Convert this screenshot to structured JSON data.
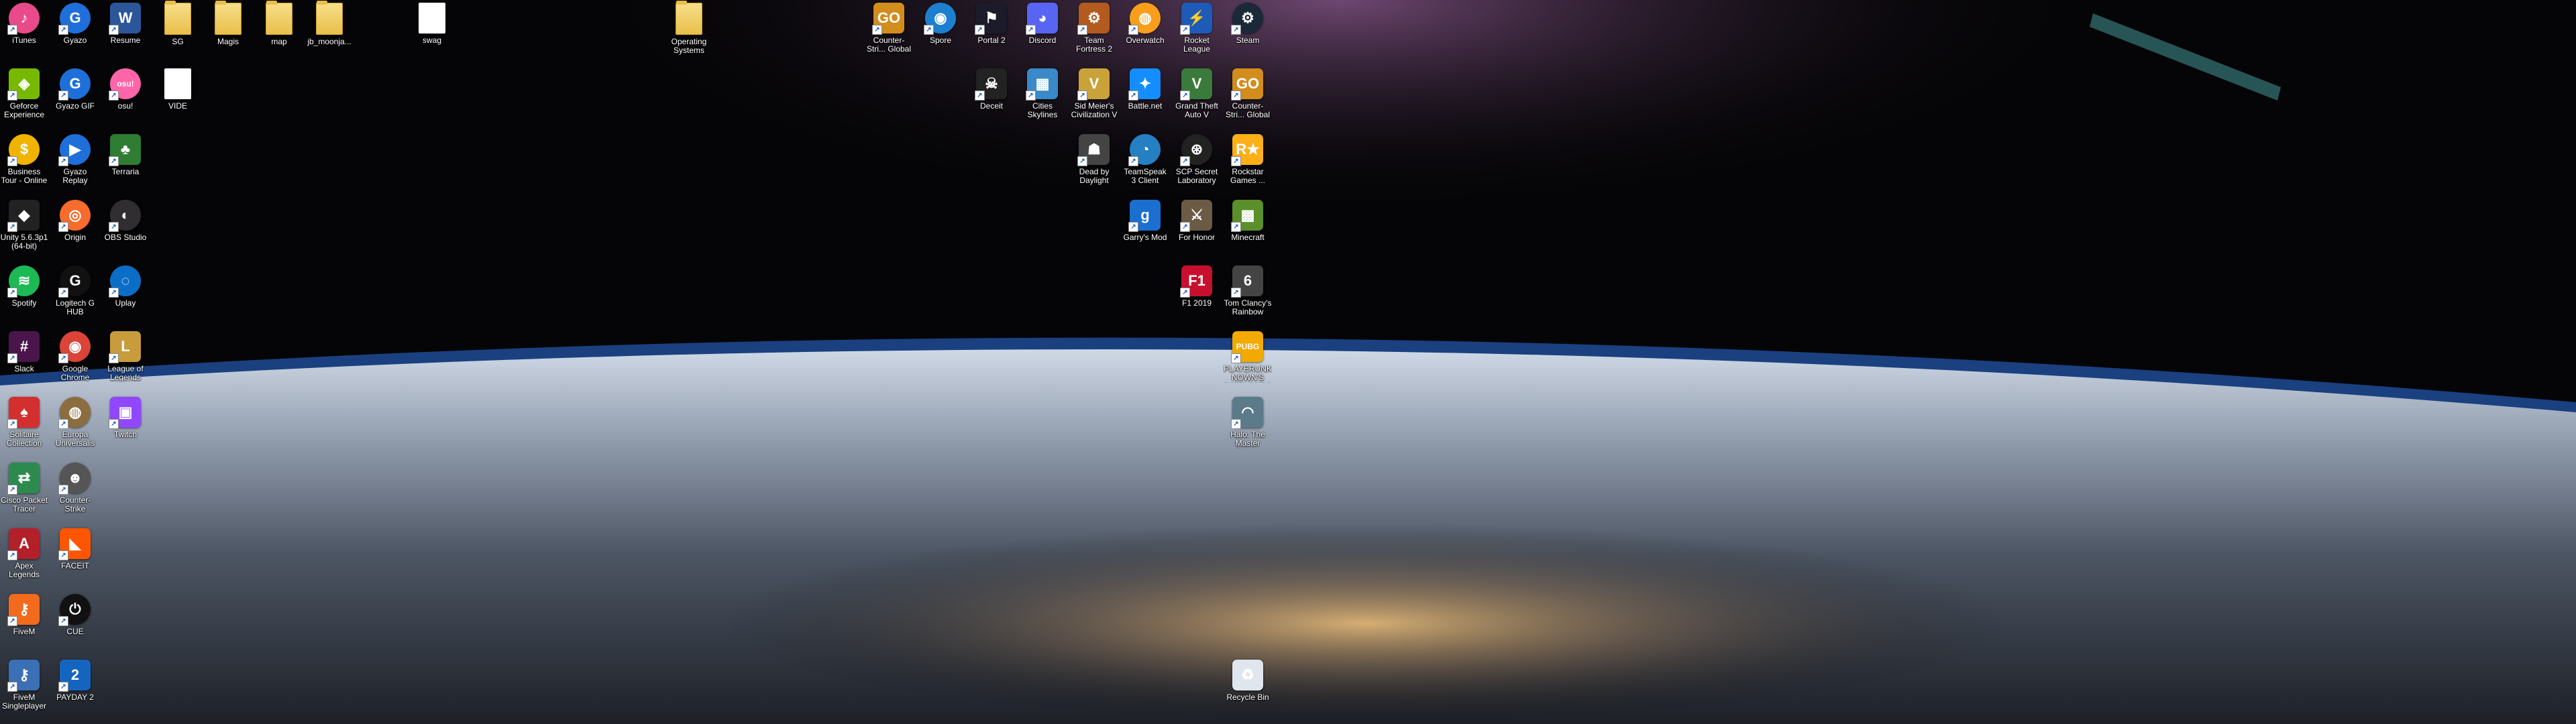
{
  "desktop": {
    "icons": [
      {
        "label": "iTunes",
        "icon": "itunes-icon",
        "symbol": "♪",
        "color": "#e84a8a",
        "round": true,
        "shortcut": true
      },
      {
        "label": "Gyazo",
        "icon": "gyazo-icon",
        "symbol": "G",
        "color": "#1e6fd9",
        "round": true,
        "shortcut": true
      },
      {
        "label": "Resume",
        "icon": "word-icon",
        "symbol": "W",
        "color": "#2b579a",
        "shortcut": true
      },
      {
        "label": "SG",
        "icon": "folder-icon",
        "folder": true
      },
      {
        "label": "Magis",
        "icon": "folder-icon",
        "folder": true
      },
      {
        "label": "map",
        "icon": "folder-icon",
        "folder": true
      },
      {
        "label": "jb_moonja...",
        "icon": "folder-icon",
        "folder": true
      },
      {
        "label": "swag",
        "icon": "pdf-icon",
        "doc": true
      },
      {
        "label": "Operating Systems",
        "icon": "folder-icon",
        "folder": true
      },
      {
        "label": "Counter-Stri... Global Offe...",
        "icon": "csgo-icon",
        "symbol": "GO",
        "color": "#d28d1c",
        "shortcut": true
      },
      {
        "label": "Spore",
        "icon": "spore-icon",
        "symbol": "◉",
        "color": "#1d7fd0",
        "round": true,
        "shortcut": true
      },
      {
        "label": "Portal 2",
        "icon": "portal2-icon",
        "symbol": "⚑",
        "color": "#1b1b2a",
        "shortcut": true
      },
      {
        "label": "Discord",
        "icon": "discord-icon",
        "symbol": "◕",
        "color": "#5865f2",
        "shortcut": true
      },
      {
        "label": "Team Fortress 2",
        "icon": "tf2-icon",
        "symbol": "⚙",
        "color": "#b35a1f",
        "shortcut": true
      },
      {
        "label": "Overwatch",
        "icon": "overwatch-icon",
        "symbol": "◍",
        "color": "#f99e1a",
        "round": true,
        "shortcut": true
      },
      {
        "label": "Rocket League",
        "icon": "rocket-league-icon",
        "symbol": "⚡",
        "color": "#1e5ab8",
        "shortcut": true
      },
      {
        "label": "Steam",
        "icon": "steam-icon",
        "symbol": "⚙",
        "color": "#1b2838",
        "round": true,
        "shortcut": true
      },
      {
        "label": "Geforce Experience",
        "icon": "geforce-icon",
        "symbol": "◈",
        "color": "#76b900",
        "shortcut": true
      },
      {
        "label": "Gyazo GIF",
        "icon": "gyazo-gif-icon",
        "symbol": "G",
        "color": "#1e6fd9",
        "round": true,
        "shortcut": true
      },
      {
        "label": "osu!",
        "icon": "osu-icon",
        "symbol": "osu!",
        "color": "#ff66aa",
        "round": true,
        "shortcut": true
      },
      {
        "label": "VIDE",
        "icon": "file-icon",
        "doc": true
      },
      {
        "label": "Deceit",
        "icon": "deceit-icon",
        "symbol": "☠",
        "color": "#222",
        "shortcut": true
      },
      {
        "label": "Cities Skylines",
        "icon": "cities-skylines-icon",
        "symbol": "▦",
        "color": "#3a89c9",
        "shortcut": true
      },
      {
        "label": "Sid Meier's Civilization V",
        "icon": "civ5-icon",
        "symbol": "V",
        "color": "#c9a23a",
        "shortcut": true
      },
      {
        "label": "Battle.net",
        "icon": "battlenet-icon",
        "symbol": "✦",
        "color": "#148eff",
        "shortcut": true
      },
      {
        "label": "Grand Theft Auto V",
        "icon": "gta5-icon",
        "symbol": "V",
        "color": "#3a7a3a",
        "shortcut": true
      },
      {
        "label": "Counter-Stri... Global Offe...",
        "icon": "csgo-icon",
        "symbol": "GO",
        "color": "#d28d1c",
        "shortcut": true
      },
      {
        "label": "Business Tour - Online M...",
        "icon": "business-tour-icon",
        "symbol": "$",
        "color": "#f0b400",
        "round": true,
        "shortcut": true
      },
      {
        "label": "Gyazo Replay",
        "icon": "gyazo-replay-icon",
        "symbol": "▶",
        "color": "#1e6fd9",
        "round": true,
        "shortcut": true
      },
      {
        "label": "Terraria",
        "icon": "terraria-icon",
        "symbol": "♣",
        "color": "#2e7d32",
        "shortcut": true
      },
      {
        "label": "Dead by Daylight",
        "icon": "dead-by-daylight-icon",
        "symbol": "☗",
        "color": "#444",
        "shortcut": true
      },
      {
        "label": "TeamSpeak 3 Client",
        "icon": "teamspeak-icon",
        "symbol": "◔",
        "color": "#2580c3",
        "round": true,
        "shortcut": true
      },
      {
        "label": "SCP Secret Laboratory",
        "icon": "scp-icon",
        "symbol": "⊛",
        "color": "#222",
        "round": true,
        "shortcut": true
      },
      {
        "label": "Rockstar Games ...",
        "icon": "rockstar-icon",
        "symbol": "R★",
        "color": "#fcaf17",
        "shortcut": true
      },
      {
        "label": "Unity 5.6.3p1 (64-bit)",
        "icon": "unity-icon",
        "symbol": "◆",
        "color": "#222",
        "shortcut": true
      },
      {
        "label": "Origin",
        "icon": "origin-icon",
        "symbol": "◎",
        "color": "#f56c2d",
        "round": true,
        "shortcut": true
      },
      {
        "label": "OBS Studio",
        "icon": "obs-icon",
        "symbol": "◐",
        "color": "#302e31",
        "round": true,
        "shortcut": true
      },
      {
        "label": "Garry's Mod",
        "icon": "garrys-mod-icon",
        "symbol": "g",
        "color": "#1a6fd1",
        "shortcut": true
      },
      {
        "label": "For Honor",
        "icon": "for-honor-icon",
        "symbol": "⚔",
        "color": "#6b5b45",
        "shortcut": true
      },
      {
        "label": "Minecraft",
        "icon": "minecraft-icon",
        "symbol": "▩",
        "color": "#5a8f2b",
        "shortcut": true
      },
      {
        "label": "Spotify",
        "icon": "spotify-icon",
        "symbol": "≋",
        "color": "#1db954",
        "round": true,
        "shortcut": true
      },
      {
        "label": "Logitech G HUB",
        "icon": "logitech-ghub-icon",
        "symbol": "G",
        "color": "#111",
        "round": true,
        "shortcut": true
      },
      {
        "label": "Uplay",
        "icon": "uplay-icon",
        "symbol": "◌",
        "color": "#0b6ec6",
        "round": true,
        "shortcut": true
      },
      {
        "label": "F1 2019",
        "icon": "f1-2019-icon",
        "symbol": "F1",
        "color": "#c8102e",
        "shortcut": true
      },
      {
        "label": "Tom Clancy's Rainbow Six...",
        "icon": "rainbow-six-icon",
        "symbol": "6",
        "color": "#444",
        "shortcut": true
      },
      {
        "label": "Slack",
        "icon": "slack-icon",
        "symbol": "#",
        "color": "#4a154b",
        "shortcut": true
      },
      {
        "label": "Google Chrome",
        "icon": "chrome-icon",
        "symbol": "◉",
        "color": "#db4437",
        "round": true,
        "shortcut": true
      },
      {
        "label": "League of Legends",
        "icon": "league-icon",
        "symbol": "L",
        "color": "#c89b3c",
        "shortcut": true
      },
      {
        "label": "PLAYERUNKNOWN'S BATTLEGROUNDS",
        "icon": "pubg-icon",
        "symbol": "PUBG",
        "color": "#f2a900",
        "shortcut": true
      },
      {
        "label": "Solitaire Collection",
        "icon": "solitaire-icon",
        "symbol": "♠",
        "color": "#d32f2f",
        "shortcut": true
      },
      {
        "label": "Europa Universalis IV",
        "icon": "europa-universalis-icon",
        "symbol": "◍",
        "color": "#8c6d3f",
        "round": true,
        "shortcut": true
      },
      {
        "label": "Twitch",
        "icon": "twitch-icon",
        "symbol": "▣",
        "color": "#9146ff",
        "shortcut": true
      },
      {
        "label": "Halo: The Master Chief...",
        "icon": "halo-icon",
        "symbol": "◠",
        "color": "#5b7a8a",
        "shortcut": true
      },
      {
        "label": "Cisco Packet Tracer",
        "icon": "packet-tracer-icon",
        "symbol": "⇄",
        "color": "#2d8a4e",
        "shortcut": true
      },
      {
        "label": "Counter-Strike Source",
        "icon": "cs-source-icon",
        "symbol": "☻",
        "color": "#555",
        "round": true,
        "shortcut": true
      },
      {
        "label": "Apex Legends",
        "icon": "apex-icon",
        "symbol": "A",
        "color": "#b3202a",
        "shortcut": true
      },
      {
        "label": "FACEIT",
        "icon": "faceit-icon",
        "symbol": "◣",
        "color": "#ff5500",
        "shortcut": true
      },
      {
        "label": "FiveM",
        "icon": "fivem-icon",
        "symbol": "⚷",
        "color": "#f26b1d",
        "shortcut": true
      },
      {
        "label": "CUE",
        "icon": "corsair-cue-icon",
        "symbol": "⏻",
        "color": "#111",
        "round": true,
        "shortcut": true
      },
      {
        "label": "FiveM Singleplayer",
        "icon": "fivem-singleplayer-icon",
        "symbol": "⚷",
        "color": "#3b6fb6",
        "shortcut": true
      },
      {
        "label": "PAYDAY 2",
        "icon": "payday2-icon",
        "symbol": "2",
        "color": "#1565c0",
        "shortcut": true
      },
      {
        "label": "Recycle Bin",
        "icon": "recycle-bin-icon",
        "symbol": "♻",
        "color": "#dfe6ee",
        "round": false,
        "shortcut": false
      }
    ]
  }
}
